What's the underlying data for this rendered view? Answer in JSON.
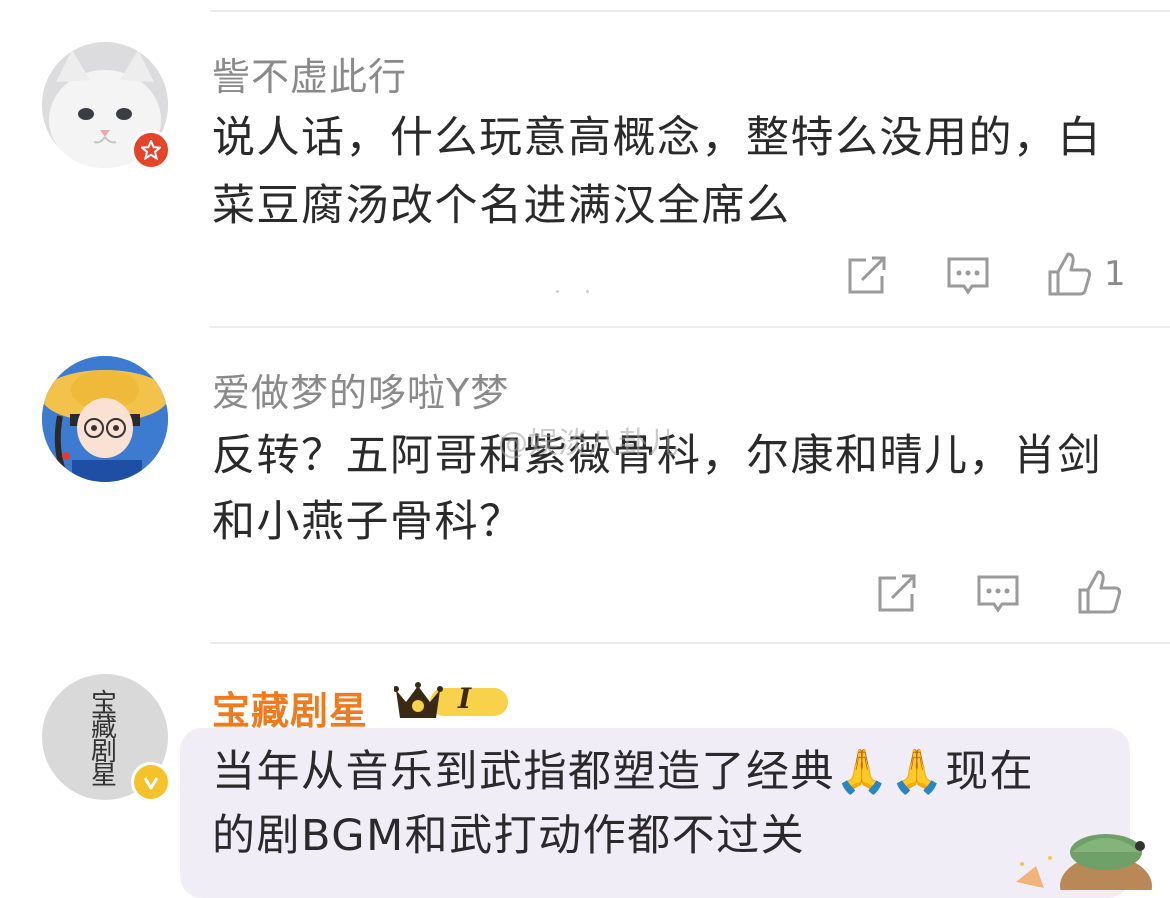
{
  "comments": [
    {
      "username": "訾不虚此行",
      "line1": "说人话，什么玩意高概念，整特么没用的，白",
      "line2": "菜豆腐汤改个名进满汉全席么",
      "likes": "1",
      "avatar_icon": "white-cat-avatar",
      "badge_icon": "red-star-badge-icon"
    },
    {
      "username": "爱做梦的哆啦Y梦",
      "line1": "反转？五阿哥和紫薇骨科，尔康和晴儿，肖剑",
      "line2": "和小燕子骨科？",
      "avatar_icon": "girl-straw-hat-avatar"
    },
    {
      "username": "宝藏剧星",
      "line1": "当年从音乐到武指都塑造了经典🙏🙏现在",
      "line2": "的剧BGM和武打动作都不过关",
      "avatar_icon": "calligraphy-avatar",
      "avatar_text": "宝藏剧星",
      "badge_icon": "yellow-verified-badge-icon",
      "level_badge": "I",
      "bubble_color": "#f1edf6"
    }
  ],
  "watermark": "@娱淡八卦儿",
  "colors": {
    "username_gray": "#8a8a8a",
    "username_orange": "#f07a1e",
    "text": "#2a2a2a",
    "icon_gray": "#9a9a9a"
  }
}
